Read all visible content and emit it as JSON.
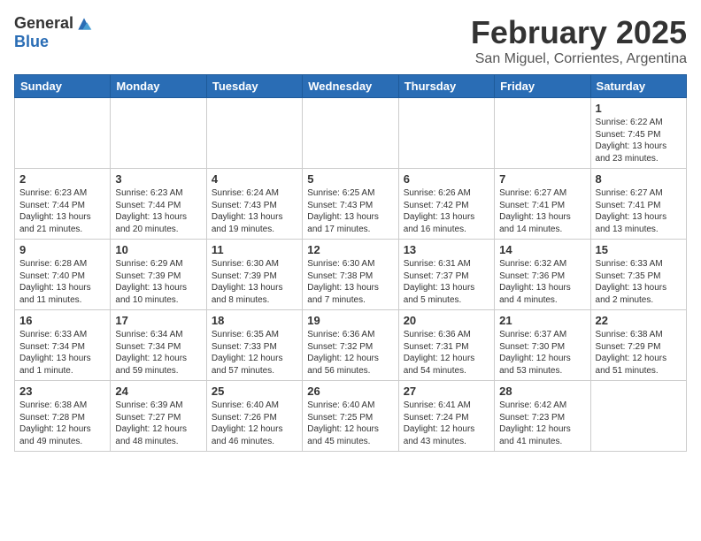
{
  "header": {
    "logo_general": "General",
    "logo_blue": "Blue",
    "calendar_title": "February 2025",
    "calendar_subtitle": "San Miguel, Corrientes, Argentina"
  },
  "weekdays": [
    "Sunday",
    "Monday",
    "Tuesday",
    "Wednesday",
    "Thursday",
    "Friday",
    "Saturday"
  ],
  "weeks": [
    [
      {
        "day": "",
        "info": ""
      },
      {
        "day": "",
        "info": ""
      },
      {
        "day": "",
        "info": ""
      },
      {
        "day": "",
        "info": ""
      },
      {
        "day": "",
        "info": ""
      },
      {
        "day": "",
        "info": ""
      },
      {
        "day": "1",
        "info": "Sunrise: 6:22 AM\nSunset: 7:45 PM\nDaylight: 13 hours and 23 minutes."
      }
    ],
    [
      {
        "day": "2",
        "info": "Sunrise: 6:23 AM\nSunset: 7:44 PM\nDaylight: 13 hours and 21 minutes."
      },
      {
        "day": "3",
        "info": "Sunrise: 6:23 AM\nSunset: 7:44 PM\nDaylight: 13 hours and 20 minutes."
      },
      {
        "day": "4",
        "info": "Sunrise: 6:24 AM\nSunset: 7:43 PM\nDaylight: 13 hours and 19 minutes."
      },
      {
        "day": "5",
        "info": "Sunrise: 6:25 AM\nSunset: 7:43 PM\nDaylight: 13 hours and 17 minutes."
      },
      {
        "day": "6",
        "info": "Sunrise: 6:26 AM\nSunset: 7:42 PM\nDaylight: 13 hours and 16 minutes."
      },
      {
        "day": "7",
        "info": "Sunrise: 6:27 AM\nSunset: 7:41 PM\nDaylight: 13 hours and 14 minutes."
      },
      {
        "day": "8",
        "info": "Sunrise: 6:27 AM\nSunset: 7:41 PM\nDaylight: 13 hours and 13 minutes."
      }
    ],
    [
      {
        "day": "9",
        "info": "Sunrise: 6:28 AM\nSunset: 7:40 PM\nDaylight: 13 hours and 11 minutes."
      },
      {
        "day": "10",
        "info": "Sunrise: 6:29 AM\nSunset: 7:39 PM\nDaylight: 13 hours and 10 minutes."
      },
      {
        "day": "11",
        "info": "Sunrise: 6:30 AM\nSunset: 7:39 PM\nDaylight: 13 hours and 8 minutes."
      },
      {
        "day": "12",
        "info": "Sunrise: 6:30 AM\nSunset: 7:38 PM\nDaylight: 13 hours and 7 minutes."
      },
      {
        "day": "13",
        "info": "Sunrise: 6:31 AM\nSunset: 7:37 PM\nDaylight: 13 hours and 5 minutes."
      },
      {
        "day": "14",
        "info": "Sunrise: 6:32 AM\nSunset: 7:36 PM\nDaylight: 13 hours and 4 minutes."
      },
      {
        "day": "15",
        "info": "Sunrise: 6:33 AM\nSunset: 7:35 PM\nDaylight: 13 hours and 2 minutes."
      }
    ],
    [
      {
        "day": "16",
        "info": "Sunrise: 6:33 AM\nSunset: 7:34 PM\nDaylight: 13 hours and 1 minute."
      },
      {
        "day": "17",
        "info": "Sunrise: 6:34 AM\nSunset: 7:34 PM\nDaylight: 12 hours and 59 minutes."
      },
      {
        "day": "18",
        "info": "Sunrise: 6:35 AM\nSunset: 7:33 PM\nDaylight: 12 hours and 57 minutes."
      },
      {
        "day": "19",
        "info": "Sunrise: 6:36 AM\nSunset: 7:32 PM\nDaylight: 12 hours and 56 minutes."
      },
      {
        "day": "20",
        "info": "Sunrise: 6:36 AM\nSunset: 7:31 PM\nDaylight: 12 hours and 54 minutes."
      },
      {
        "day": "21",
        "info": "Sunrise: 6:37 AM\nSunset: 7:30 PM\nDaylight: 12 hours and 53 minutes."
      },
      {
        "day": "22",
        "info": "Sunrise: 6:38 AM\nSunset: 7:29 PM\nDaylight: 12 hours and 51 minutes."
      }
    ],
    [
      {
        "day": "23",
        "info": "Sunrise: 6:38 AM\nSunset: 7:28 PM\nDaylight: 12 hours and 49 minutes."
      },
      {
        "day": "24",
        "info": "Sunrise: 6:39 AM\nSunset: 7:27 PM\nDaylight: 12 hours and 48 minutes."
      },
      {
        "day": "25",
        "info": "Sunrise: 6:40 AM\nSunset: 7:26 PM\nDaylight: 12 hours and 46 minutes."
      },
      {
        "day": "26",
        "info": "Sunrise: 6:40 AM\nSunset: 7:25 PM\nDaylight: 12 hours and 45 minutes."
      },
      {
        "day": "27",
        "info": "Sunrise: 6:41 AM\nSunset: 7:24 PM\nDaylight: 12 hours and 43 minutes."
      },
      {
        "day": "28",
        "info": "Sunrise: 6:42 AM\nSunset: 7:23 PM\nDaylight: 12 hours and 41 minutes."
      },
      {
        "day": "",
        "info": ""
      }
    ]
  ]
}
